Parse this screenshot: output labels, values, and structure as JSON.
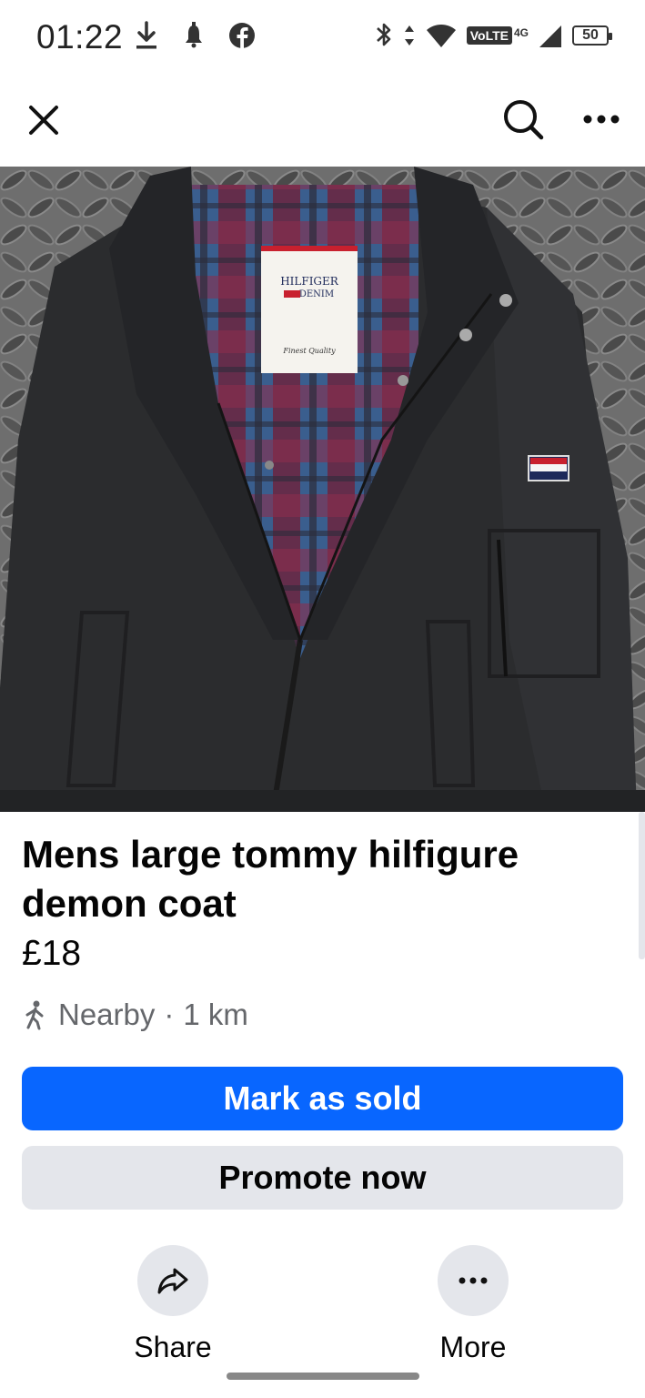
{
  "status_bar": {
    "time": "01:22",
    "battery": "50",
    "network_badge": "VoLTE",
    "network_type": "4G",
    "left_icons": [
      "download-icon",
      "notification-icon",
      "facebook-icon"
    ],
    "right_icons": [
      "bluetooth-icon",
      "data-arrows-icon",
      "wifi-icon",
      "volte-icon",
      "signal-icon",
      "battery-icon"
    ]
  },
  "top_bar": {
    "icons": [
      "close-icon",
      "search-icon",
      "more-horizontal-icon"
    ]
  },
  "photo": {
    "label_brand_line1": "HILFIGER",
    "label_brand_line2": "DENIM",
    "label_tagline": "Finest Quality"
  },
  "listing": {
    "title": "Mens large tommy hilfigure demon coat",
    "price": "£18",
    "location_prefix": "Nearby",
    "location_separator": "·",
    "location_distance": "1 km"
  },
  "buttons": {
    "mark_sold": "Mark as sold",
    "promote": "Promote now"
  },
  "actions": {
    "share": "Share",
    "more": "More"
  },
  "colors": {
    "primary": "#0866ff",
    "secondary_bg": "#e4e6eb",
    "text_primary": "#050505",
    "text_secondary": "#65676b"
  }
}
